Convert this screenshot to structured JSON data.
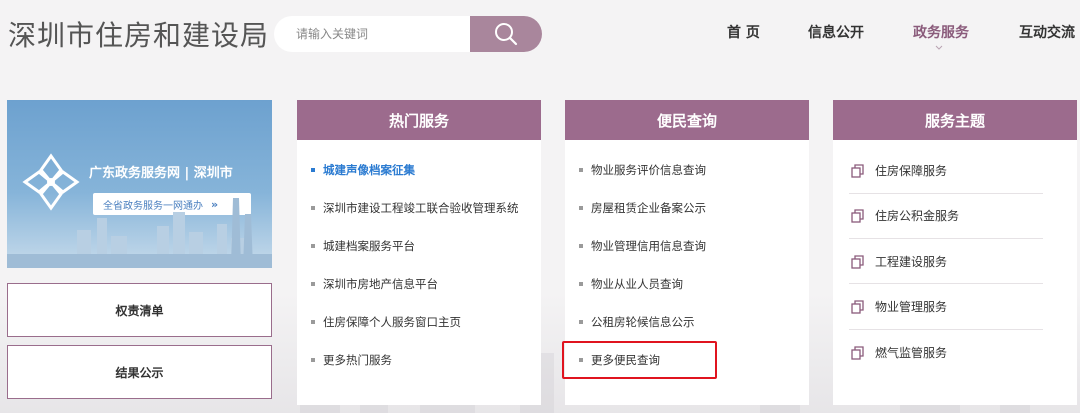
{
  "header": {
    "site_title": "深圳市住房和建设局",
    "search_placeholder": "请输入关键词",
    "nav": [
      "首 页",
      "信息公开",
      "政务服务",
      "互动交流"
    ],
    "active_nav": "政务服务"
  },
  "left": {
    "banner_title": "广东政务服务网 | 深圳市",
    "banner_button": "全省政务服务一网通办",
    "banner_button_arrow": "»",
    "boxes": [
      "权责清单",
      "结果公示"
    ]
  },
  "panels": {
    "hot": {
      "title": "热门服务",
      "items": [
        "城建声像档案征集",
        "深圳市建设工程竣工联合验收管理系统",
        "城建档案服务平台",
        "深圳市房地产信息平台",
        "住房保障个人服务窗口主页",
        "更多热门服务"
      ]
    },
    "query": {
      "title": "便民查询",
      "items": [
        "物业服务评价信息查询",
        "房屋租赁企业备案公示",
        "物业管理信用信息查询",
        "物业从业人员查询",
        "公租房轮候信息公示",
        "更多便民查询"
      ]
    },
    "topics": {
      "title": "服务主题",
      "items": [
        "住房保障服务",
        "住房公积金服务",
        "工程建设服务",
        "物业管理服务",
        "燃气监管服务"
      ]
    }
  },
  "colors": {
    "accent": "#9c6b8d",
    "search_button": "#a9869c",
    "active_nav": "#8a5b7b",
    "highlight_link": "#2b7bd1",
    "outline_red": "#e0141f"
  }
}
